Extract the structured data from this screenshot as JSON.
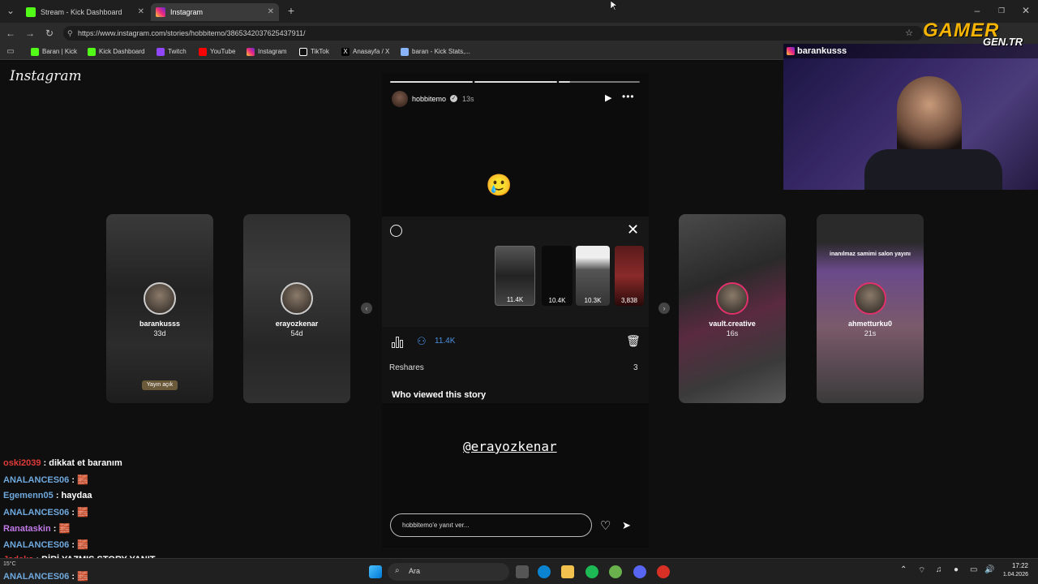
{
  "tabs": [
    {
      "label": "Stream - Kick Dashboard",
      "active": false,
      "favicon_color": "#53fc18"
    },
    {
      "label": "Instagram",
      "active": true,
      "favicon_color": "#e1306c"
    }
  ],
  "address": {
    "url": "https://www.instagram.com/stories/hobbitemo/3865342037625437911/"
  },
  "bookmarks": [
    {
      "label": "Baran | Kick",
      "icon": "kick-icon",
      "color": "#53fc18"
    },
    {
      "label": "Kick Dashboard",
      "icon": "kick-icon",
      "color": "#53fc18"
    },
    {
      "label": "Twitch",
      "icon": "twitch-icon",
      "color": "#9146ff"
    },
    {
      "label": "YouTube",
      "icon": "youtube-icon",
      "color": "#ff0000"
    },
    {
      "label": "Instagram",
      "icon": "instagram-icon",
      "color": "#e1306c"
    },
    {
      "label": "TikTok",
      "icon": "tiktok-icon",
      "color": "#ffffff"
    },
    {
      "label": "Anasayfa / X",
      "icon": "x-icon",
      "color": "#ffffff"
    },
    {
      "label": "baran - Kick Stats,...",
      "icon": "stats-icon",
      "color": "#8ab4f8"
    }
  ],
  "instagram": {
    "logo": "Instagram"
  },
  "side_stories": [
    {
      "name": "barankusss",
      "time": "33d",
      "caption": "Yayın açık"
    },
    {
      "name": "erayozkenar",
      "time": "54d",
      "caption": ""
    },
    {
      "name": "vault.creative",
      "time": "16s",
      "caption": ""
    },
    {
      "name": "ahmetturku0",
      "time": "21s",
      "caption": "inanılmaz samimi salon yayını"
    }
  ],
  "story": {
    "username": "hobbitemo",
    "time": "13s",
    "emoji": "🥲",
    "thumbnails": [
      {
        "count": "11.4K"
      },
      {
        "count": "10.4K"
      },
      {
        "count": "10.3K"
      },
      {
        "count": "3,838"
      }
    ],
    "views_count": "11.4K",
    "reshares_label": "Reshares",
    "reshares_count": "3",
    "who_viewed": "Who viewed this story",
    "mention": "@erayozkenar",
    "reply_placeholder": "hobbitemo'e yanıt ver..."
  },
  "webcam": {
    "streamer": "barankusss",
    "overlay_brand": "GAMER",
    "overlay_sub": "GEN.TR"
  },
  "chat": [
    {
      "user": "oski2039",
      "message": ": dikkat et baranım",
      "color": "#e03a3a"
    },
    {
      "user": "ANALANCES06",
      "message": ": 🧱",
      "color": "#6fa8dc"
    },
    {
      "user": "Egemenn05",
      "message": ": haydaa",
      "color": "#6fa8dc"
    },
    {
      "user": "ANALANCES06",
      "message": ": 🧱",
      "color": "#6fa8dc"
    },
    {
      "user": "Ranataskin",
      "message": ": 🧱",
      "color": "#c27ae8"
    },
    {
      "user": "ANALANCES06",
      "message": ": 🧱",
      "color": "#6fa8dc"
    },
    {
      "user": "Jadeks",
      "message": ": BİRİ YAZMIŞ STORY YANIT",
      "color": "#e03a3a"
    },
    {
      "user": "ANALANCES06",
      "message": ": 🧱",
      "color": "#6fa8dc"
    }
  ],
  "taskbar": {
    "search": "Ara",
    "time": "17:22",
    "date": "1.04.2026",
    "weather": "15°C"
  }
}
